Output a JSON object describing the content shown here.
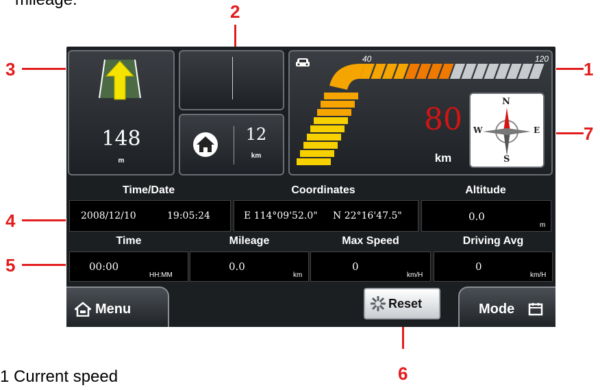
{
  "top_caption": "mileage.",
  "bottom_caption": "1 Current speed",
  "callouts": {
    "c1": "1",
    "c2": "2",
    "c3": "3",
    "c4": "4",
    "c5": "5",
    "c6": "6",
    "c7": "7"
  },
  "turn": {
    "distance": "148",
    "unit": "m"
  },
  "home": {
    "distance": "12",
    "unit": "km"
  },
  "speed": {
    "value": "80",
    "unit": "km",
    "scale_low": "40",
    "scale_high": "120",
    "current_kmh": 80
  },
  "compass": {
    "n": "N",
    "s": "S",
    "e": "E",
    "w": "W"
  },
  "info": {
    "time_date_label": "Time/Date",
    "date": "2008/12/10",
    "time": "19:05:24",
    "coordinates_label": "Coordinates",
    "lon": "E 114°09'52.0\"",
    "lat": "N 22°16'47.5\"",
    "altitude_label": "Altitude",
    "altitude": "0.0",
    "altitude_unit": "m"
  },
  "trip": {
    "time_label": "Time",
    "time": "00:00",
    "time_unit": "HH:MM",
    "mileage_label": "Mileage",
    "mileage": "0.0",
    "mileage_unit": "km",
    "max_speed_label": "Max Speed",
    "max_speed": "0",
    "max_speed_unit": "km/H",
    "avg_label": "Driving Avg",
    "avg": "0",
    "avg_unit": "km/H"
  },
  "buttons": {
    "menu": "Menu",
    "reset": "Reset",
    "mode": "Mode"
  },
  "colors": {
    "accent_red": "#e21d1d",
    "speed_red": "#d21414",
    "arrow_yellow": "#f5e400"
  }
}
